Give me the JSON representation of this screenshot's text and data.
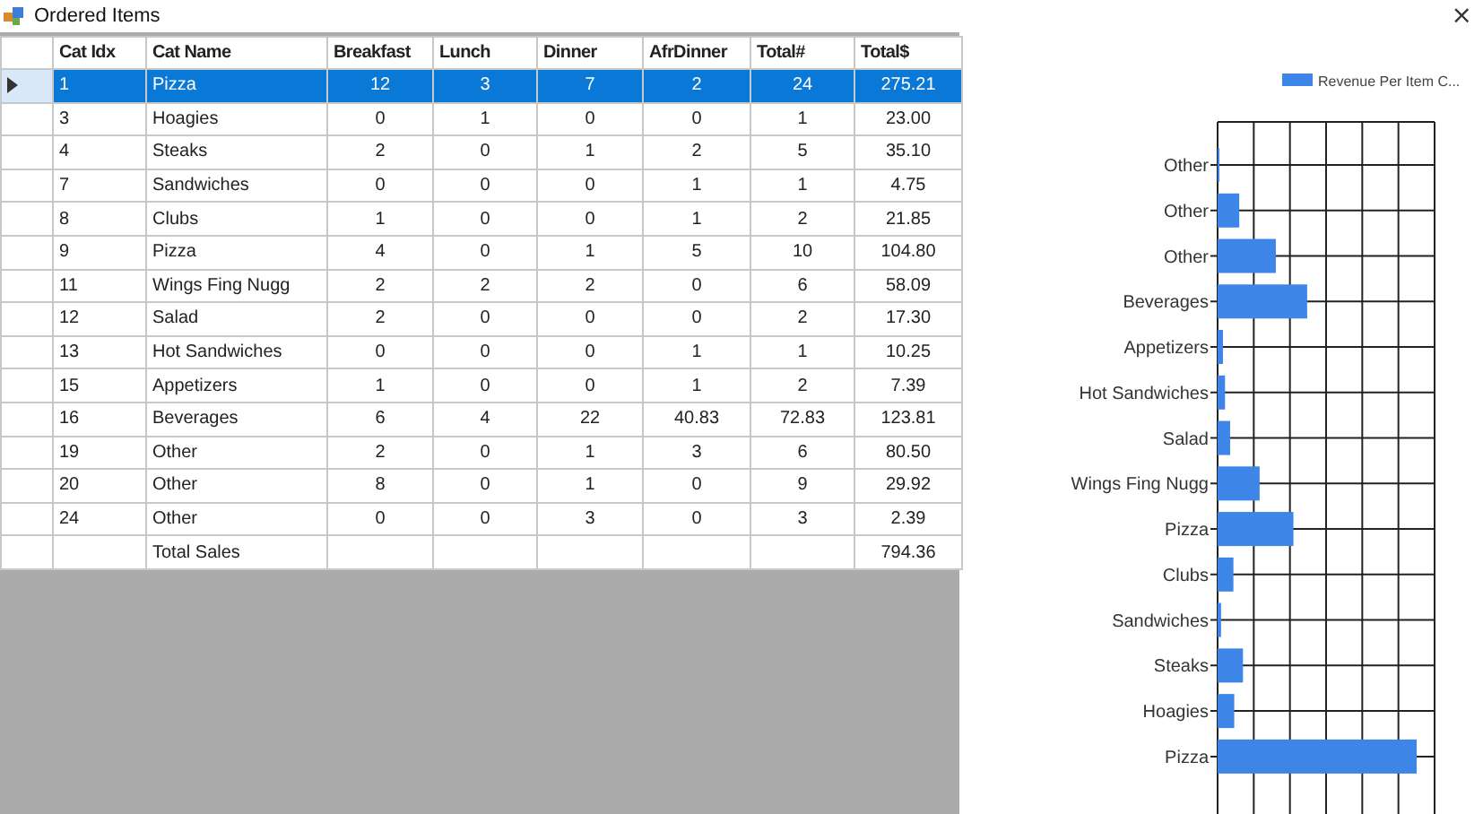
{
  "window": {
    "title": "Ordered Items",
    "close": "×"
  },
  "table": {
    "columns": [
      "Cat Idx",
      "Cat Name",
      "Breakfast",
      "Lunch",
      "Dinner",
      "AfrDinner",
      "Total#",
      "Total$"
    ],
    "rows": [
      {
        "kind": "item",
        "selected": true,
        "cells": [
          "1",
          "Pizza",
          "12",
          "3",
          "7",
          "2",
          "24",
          "275.21"
        ]
      },
      {
        "kind": "item",
        "selected": false,
        "cells": [
          "3",
          "Hoagies",
          "0",
          "1",
          "0",
          "0",
          "1",
          "23.00"
        ]
      },
      {
        "kind": "item",
        "selected": false,
        "cells": [
          "4",
          "Steaks",
          "2",
          "0",
          "1",
          "2",
          "5",
          "35.10"
        ]
      },
      {
        "kind": "item",
        "selected": false,
        "cells": [
          "7",
          "Sandwiches",
          "0",
          "0",
          "0",
          "1",
          "1",
          "4.75"
        ]
      },
      {
        "kind": "item",
        "selected": false,
        "cells": [
          "8",
          "Clubs",
          "1",
          "0",
          "0",
          "1",
          "2",
          "21.85"
        ]
      },
      {
        "kind": "item",
        "selected": false,
        "cells": [
          "9",
          "Pizza",
          "4",
          "0",
          "1",
          "5",
          "10",
          "104.80"
        ]
      },
      {
        "kind": "item",
        "selected": false,
        "cells": [
          "11",
          "Wings Fing Nugg",
          "2",
          "2",
          "2",
          "0",
          "6",
          "58.09"
        ]
      },
      {
        "kind": "item",
        "selected": false,
        "cells": [
          "12",
          "Salad",
          "2",
          "0",
          "0",
          "0",
          "2",
          "17.30"
        ]
      },
      {
        "kind": "item",
        "selected": false,
        "cells": [
          "13",
          "Hot Sandwiches",
          "0",
          "0",
          "0",
          "1",
          "1",
          "10.25"
        ]
      },
      {
        "kind": "item",
        "selected": false,
        "cells": [
          "15",
          "Appetizers",
          "1",
          "0",
          "0",
          "1",
          "2",
          "7.39"
        ]
      },
      {
        "kind": "item",
        "selected": false,
        "cells": [
          "16",
          "Beverages",
          "6",
          "4",
          "22",
          "40.83",
          "72.83",
          "123.81"
        ]
      },
      {
        "kind": "item",
        "selected": false,
        "cells": [
          "19",
          "Other",
          "2",
          "0",
          "1",
          "3",
          "6",
          "80.50"
        ]
      },
      {
        "kind": "item",
        "selected": false,
        "cells": [
          "20",
          "Other",
          "8",
          "0",
          "1",
          "0",
          "9",
          "29.92"
        ]
      },
      {
        "kind": "item",
        "selected": false,
        "cells": [
          "24",
          "Other",
          "0",
          "0",
          "3",
          "0",
          "3",
          "2.39"
        ]
      },
      {
        "kind": "total",
        "selected": false,
        "label": "Total Sales",
        "total": "794.36"
      }
    ]
  },
  "chart": {
    "legend": "Revenue Per Item C...",
    "categories": [
      "Other",
      "Other",
      "Other",
      "Beverages",
      "Appetizers",
      "Hot Sandwiches",
      "Salad",
      "Wings Fing Nugg",
      "Pizza",
      "Clubs",
      "Sandwiches",
      "Steaks",
      "Hoagies",
      "Pizza"
    ]
  }
}
